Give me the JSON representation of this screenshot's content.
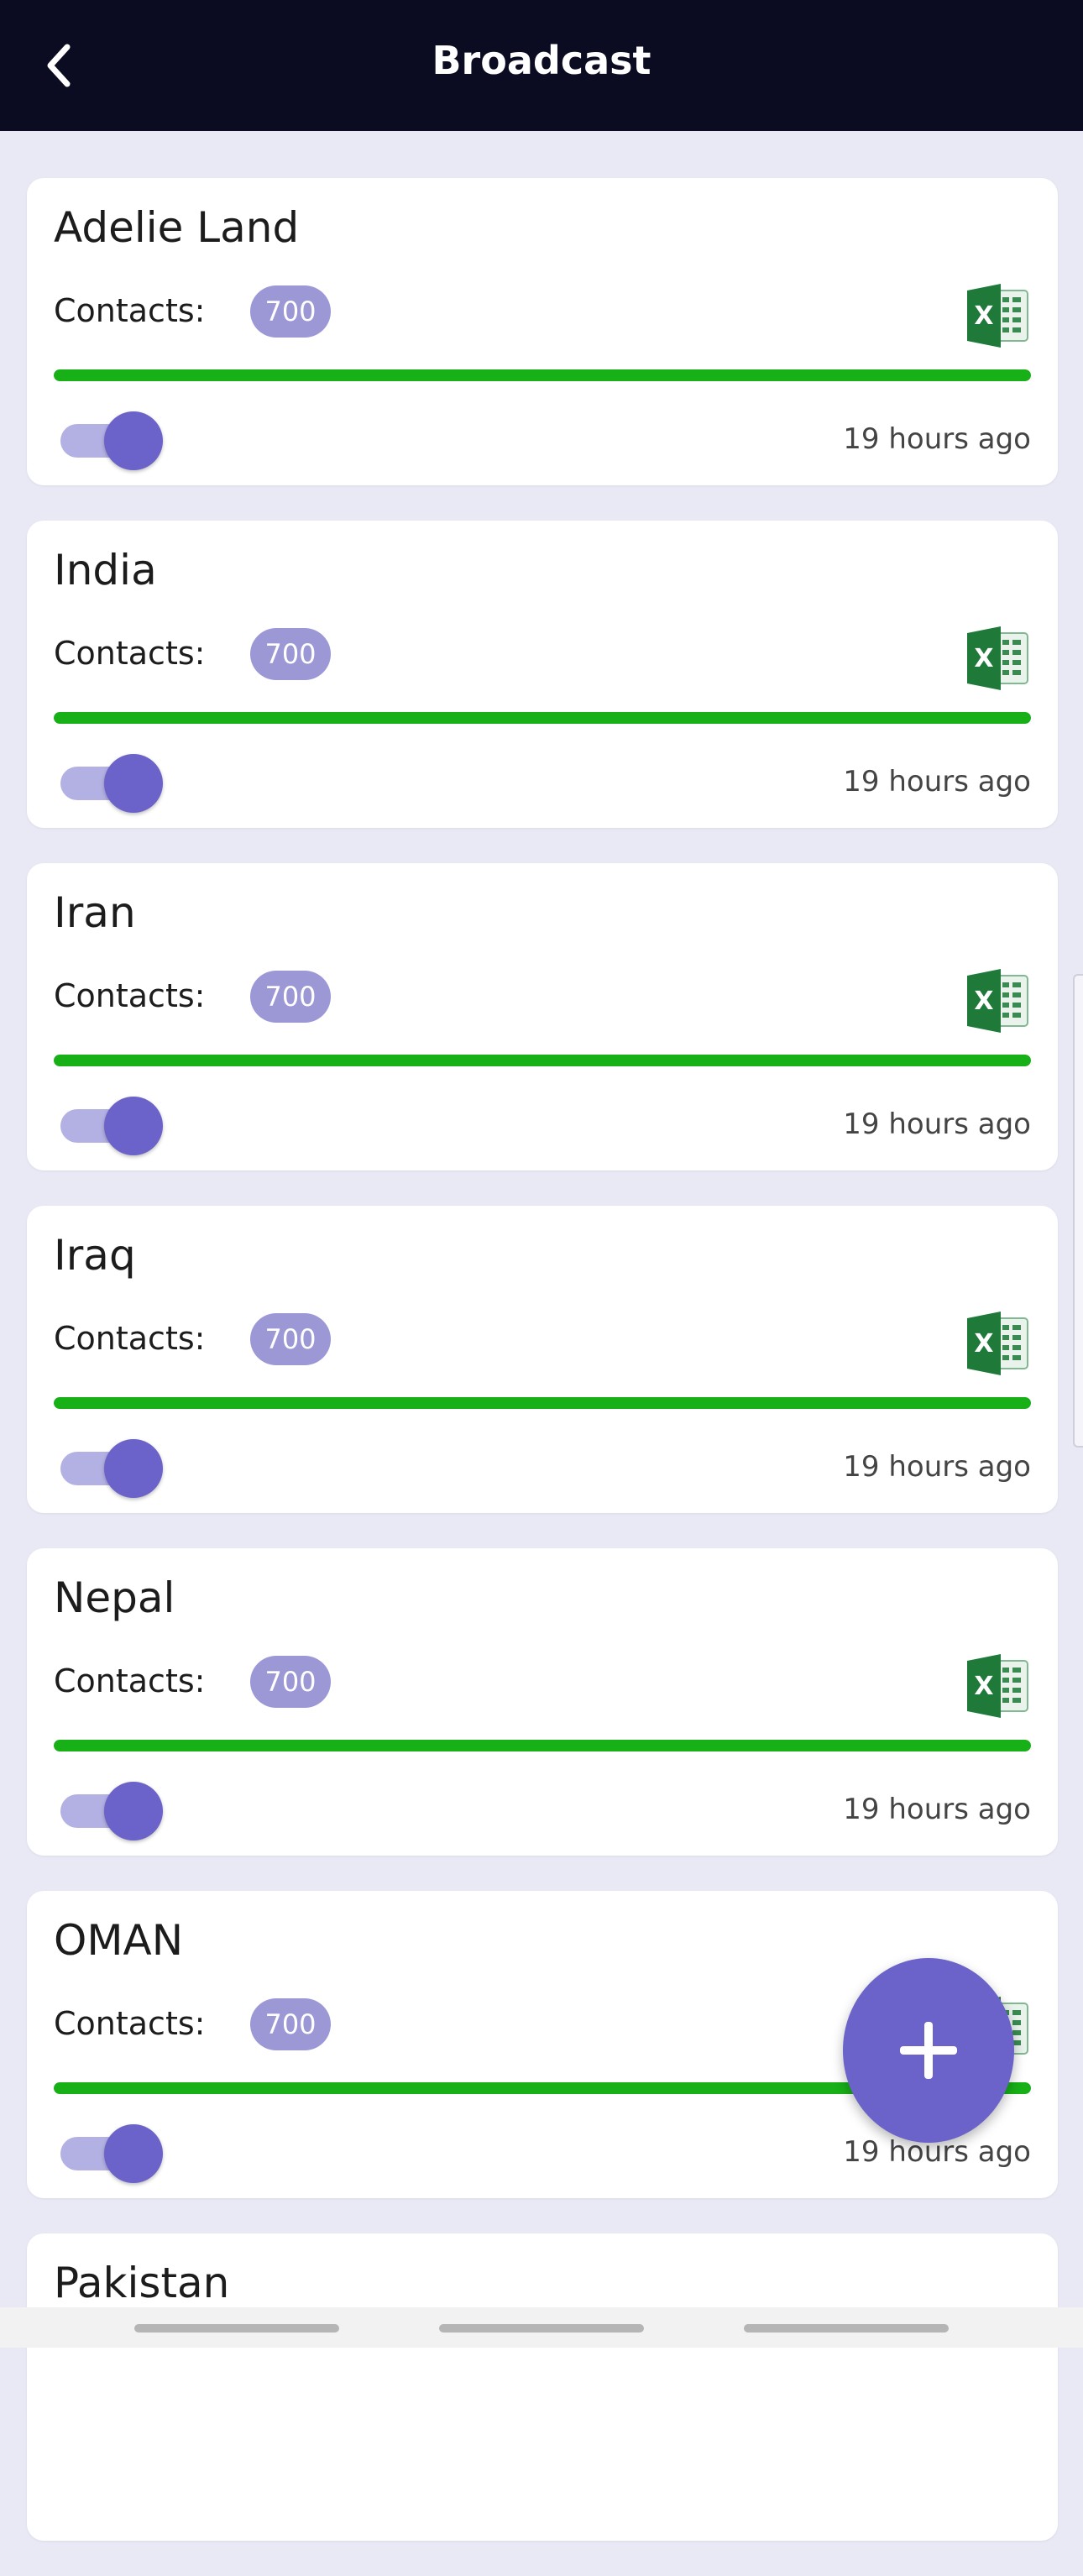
{
  "header": {
    "title": "Broadcast"
  },
  "contacts_label": "Contacts:",
  "colors": {
    "header_bg": "#0b0c22",
    "accent": "#6b63c9",
    "badge": "#9c98d6",
    "progress": "#17b017",
    "excel_green": "#1f7a3a"
  },
  "icons": {
    "back": "chevron-left-icon",
    "file": "excel-icon",
    "fab": "plus-icon"
  },
  "broadcasts": [
    {
      "name": "Adelie Land",
      "contacts": "700",
      "time": "19 hours ago",
      "progress": 1.0,
      "enabled": true
    },
    {
      "name": "India",
      "contacts": "700",
      "time": "19 hours ago",
      "progress": 1.0,
      "enabled": true
    },
    {
      "name": "Iran",
      "contacts": "700",
      "time": "19 hours ago",
      "progress": 1.0,
      "enabled": true
    },
    {
      "name": "Iraq",
      "contacts": "700",
      "time": "19 hours ago",
      "progress": 1.0,
      "enabled": true
    },
    {
      "name": "Nepal",
      "contacts": "700",
      "time": "19 hours ago",
      "progress": 1.0,
      "enabled": true
    },
    {
      "name": "OMAN",
      "contacts": "700",
      "time": "19 hours ago",
      "progress": 1.0,
      "enabled": true
    },
    {
      "name": "Pakistan"
    }
  ]
}
